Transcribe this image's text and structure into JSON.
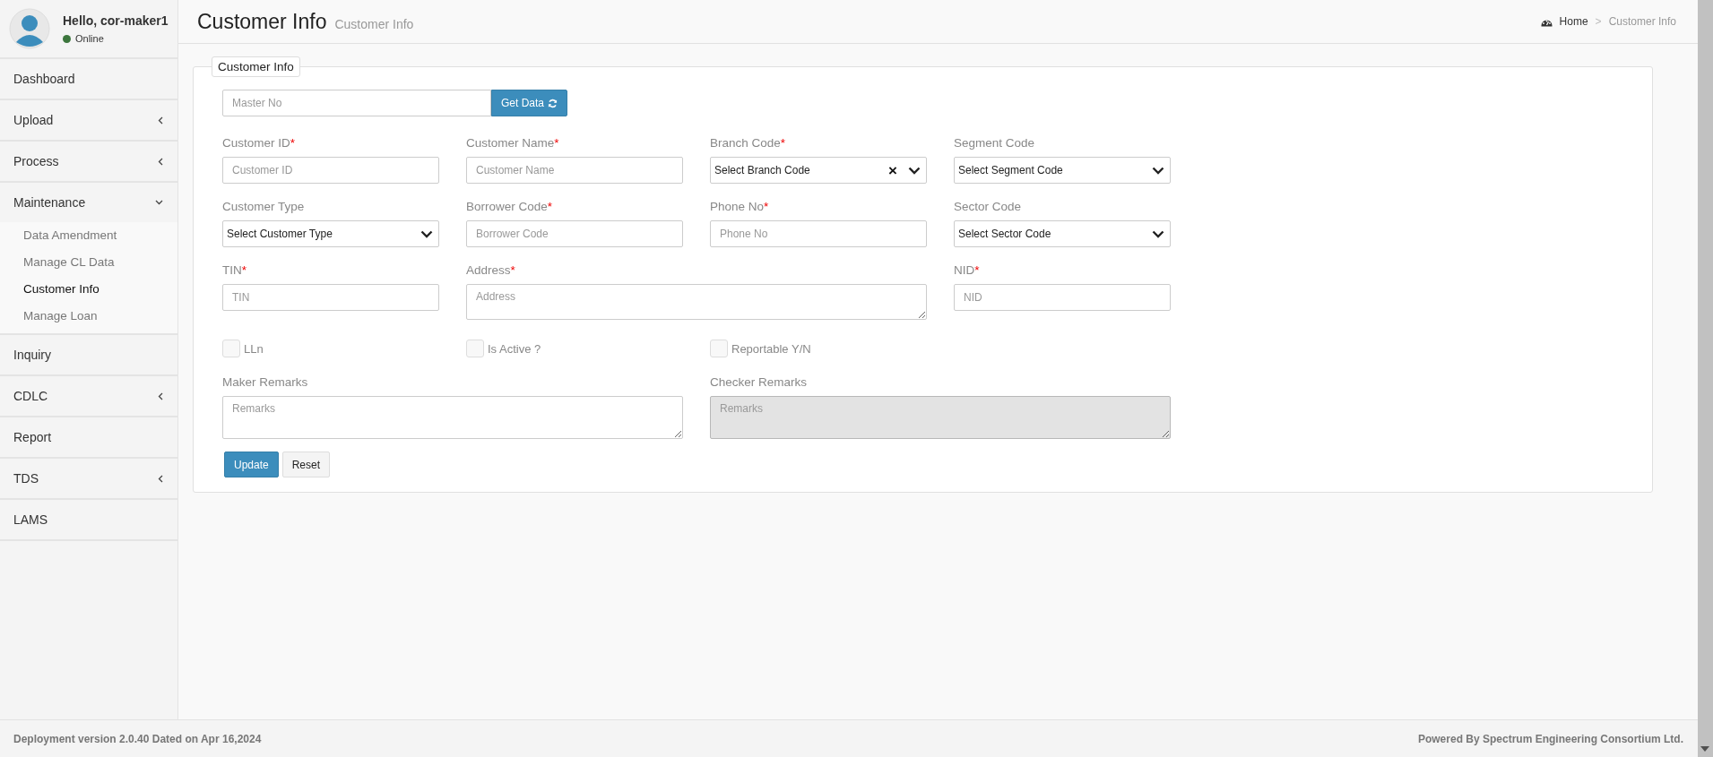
{
  "user": {
    "greeting": "Hello, cor-maker1",
    "status": {
      "label": "Online",
      "color": "#3c763d"
    }
  },
  "sidebar": {
    "items": [
      {
        "label": "Dashboard",
        "kind": "link"
      },
      {
        "label": "Upload",
        "kind": "menu",
        "expanded": false
      },
      {
        "label": "Process",
        "kind": "menu",
        "expanded": false
      },
      {
        "label": "Maintenance",
        "kind": "menu",
        "expanded": true,
        "children": [
          {
            "label": "Data Amendment",
            "selected": false
          },
          {
            "label": "Manage CL Data",
            "selected": false
          },
          {
            "label": "Customer Info",
            "selected": true
          },
          {
            "label": "Manage Loan",
            "selected": false
          }
        ]
      },
      {
        "label": "Inquiry",
        "kind": "link"
      },
      {
        "label": "CDLC",
        "kind": "menu",
        "expanded": false
      },
      {
        "label": "Report",
        "kind": "link"
      },
      {
        "label": "TDS",
        "kind": "menu",
        "expanded": false
      },
      {
        "label": "LAMS",
        "kind": "link"
      }
    ]
  },
  "header": {
    "title": "Customer Info",
    "subtitle": "Customer Info",
    "breadcrumb": [
      {
        "label": "Home"
      },
      {
        "label": ">"
      },
      {
        "label": "Customer Info"
      }
    ]
  },
  "form": {
    "legend": "Customer Info",
    "lookup": {
      "placeholder": "Master No",
      "button": "Get Data"
    },
    "fields": [
      {
        "label": "Customer ID",
        "required_mark": "*",
        "kind": "input",
        "placeholder": "Customer ID"
      },
      {
        "label": "Customer Name",
        "required_mark": "*",
        "kind": "input",
        "placeholder": "Customer Name"
      },
      {
        "label": "Branch Code",
        "required_mark": "*",
        "kind": "select",
        "placeholder": "Select Branch Code",
        "clear_icon": "×"
      },
      {
        "label": "Segment Code",
        "kind": "select",
        "placeholder": "Select Segment Code"
      },
      {
        "label": "Customer Type",
        "kind": "select",
        "placeholder": "Select Customer Type"
      },
      {
        "label": "Borrower Code",
        "required_mark": "*",
        "kind": "input",
        "placeholder": "Borrower Code"
      },
      {
        "label": "Phone No",
        "required_mark": "*",
        "kind": "input",
        "placeholder": "Phone No"
      },
      {
        "label": "Sector Code",
        "kind": "select",
        "placeholder": "Select Sector Code"
      },
      {
        "label": "TIN",
        "required_mark": "*",
        "kind": "input",
        "placeholder": "TIN"
      },
      {
        "label": "Address",
        "required_mark": "*",
        "kind": "textarea",
        "placeholder": "Address",
        "disabled": false
      },
      {
        "label": "NID",
        "required_mark": "*",
        "kind": "input",
        "placeholder": "NID"
      }
    ],
    "checkboxes": [
      {
        "label": "LLn",
        "checked": false
      },
      {
        "label": "Is Active ?",
        "checked": false
      },
      {
        "label": "Reportable Y/N",
        "checked": false
      }
    ],
    "remarks": [
      {
        "label": "Maker Remarks",
        "kind": "textarea",
        "placeholder": "Remarks",
        "disabled": false
      },
      {
        "label": "Checker Remarks",
        "kind": "textarea",
        "placeholder": "Remarks",
        "disabled": true
      }
    ],
    "buttons": [
      {
        "label": "Update",
        "kind": "primary"
      },
      {
        "label": "Reset",
        "kind": "default"
      }
    ]
  },
  "footer": {
    "left": "Deployment version 2.0.40 Dated on Apr 16,2024",
    "right": "Powered By Spectrum Engineering Consortium Ltd."
  }
}
